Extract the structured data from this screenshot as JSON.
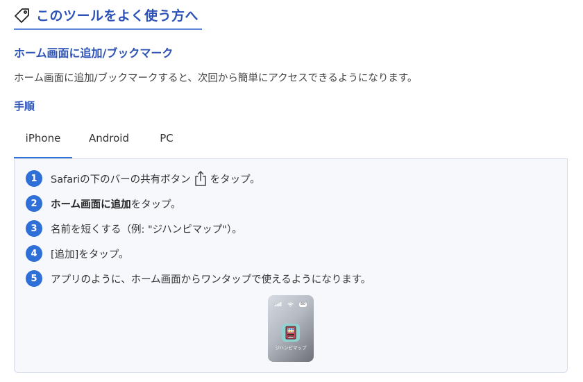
{
  "section": {
    "title": "このツールをよく使う方へ",
    "title_icon": "price-tag-icon"
  },
  "bookmark": {
    "heading": "ホーム画面に追加/ブックマーク",
    "description": "ホーム画面に追加/ブックマークすると、次回から簡単にアクセスできるようになります。",
    "steps_label": "手順"
  },
  "tabs": [
    {
      "label": "iPhone",
      "active": true
    },
    {
      "label": "Android",
      "active": false
    },
    {
      "label": "PC",
      "active": false
    }
  ],
  "steps": [
    {
      "num": "1",
      "before": "Safariの下のバーの共有ボタン",
      "icon": "share-icon",
      "after": "をタップ。"
    },
    {
      "num": "2",
      "bold": "ホーム画面に追加",
      "after": "をタップ。"
    },
    {
      "num": "3",
      "text": "名前を短くする（例: \"ジハンピマップ\"）。"
    },
    {
      "num": "4",
      "text": "[追加]をタップ。"
    },
    {
      "num": "5",
      "text": "アプリのように、ホーム画面からワンタップで使えるようになります。"
    }
  ],
  "preview": {
    "app_label": "ジハンピマップ",
    "battery": "80",
    "app_icon": "vending-machine-icon"
  },
  "colors": {
    "accent": "#2c52b7",
    "step_badge": "#2f6fd8",
    "panel_bg": "#f6f8fc"
  }
}
